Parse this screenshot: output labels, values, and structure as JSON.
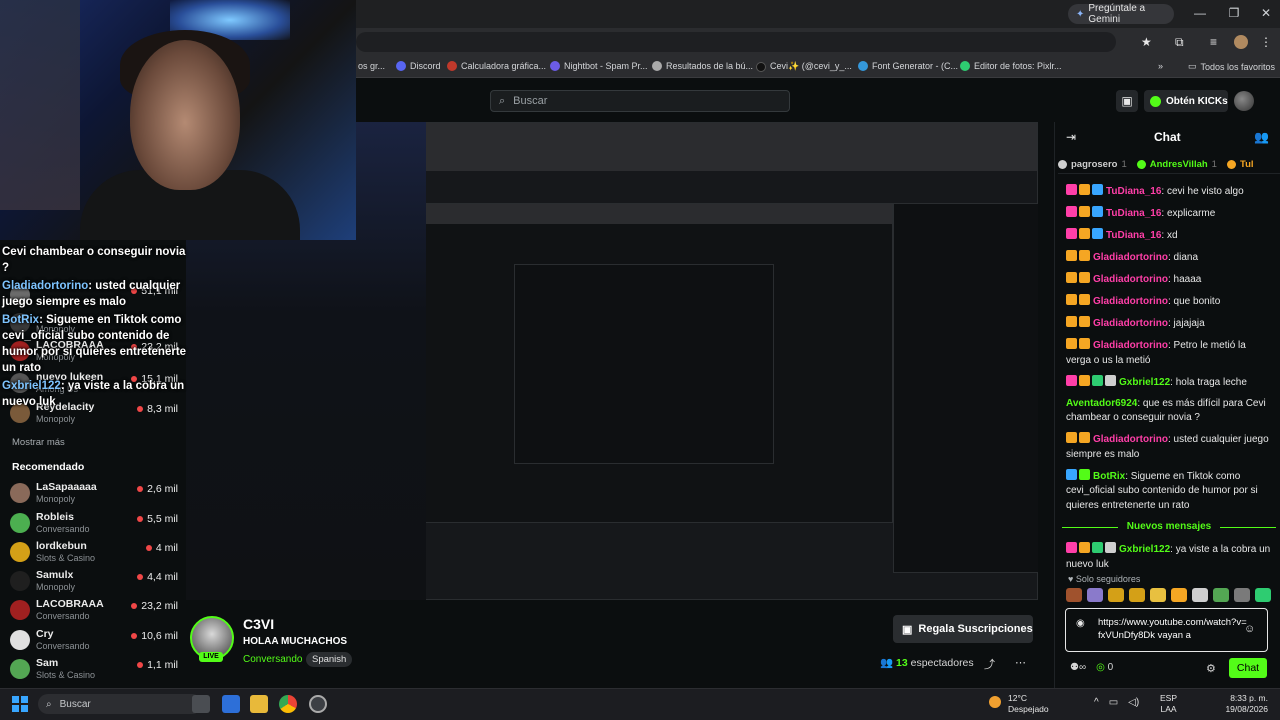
{
  "browser": {
    "gemini_button": "Pregúntale a Gemini",
    "bookmarks": [
      {
        "label": "os gr...",
        "color": "#888888"
      },
      {
        "label": "Discord",
        "color": "#5865f2"
      },
      {
        "label": "Calculadora gráfica...",
        "color": "#c0392b"
      },
      {
        "label": "Nightbot - Spam Pr...",
        "color": "#6c5ce7"
      },
      {
        "label": "Resultados de la bú...",
        "color": "#aaaaaa"
      },
      {
        "label": "Cevi✨ (@cevi_y_...",
        "color": "#111111"
      },
      {
        "label": "Font Generator - (C...",
        "color": "#3498db"
      },
      {
        "label": "Editor de fotos: Pixlr...",
        "color": "#2ecc71"
      }
    ],
    "all_favorites": "Todos los favoritos"
  },
  "header": {
    "search_placeholder": "Buscar",
    "kicks_button": "Obtén KICKs"
  },
  "overlay_chat": [
    {
      "text": "Cevi chambear o conseguir novia ?"
    },
    {
      "user": "Gladiadortorino",
      "text": ": usted cualquier juego siempre es malo"
    },
    {
      "user": "BotRix",
      "text": ": Sigueme en Tiktok como cevi_oficial subo contenido de humor por si quieres entretenerte un rato"
    },
    {
      "user": "Gxbriel122",
      "text": ": ya viste a la cobra un nuevo luk"
    }
  ],
  "sidebar": {
    "channels": [
      {
        "name": "",
        "category": "",
        "viewers": "51,1 mil",
        "color": "#6b6b6b"
      },
      {
        "name": "",
        "category": "Monopoly",
        "viewers": "",
        "color": "#3a3a3a"
      },
      {
        "name": "LACOBRAAA",
        "category": "Monopoly",
        "viewers": "23,2 mil",
        "color": "#a02020"
      },
      {
        "name": "nuevo lukeen",
        "category": "Among Us",
        "viewers": "15,1 mil",
        "color": "#555555"
      },
      {
        "name": "Reydelacity",
        "category": "Monopoly",
        "viewers": "8,3 mil",
        "color": "#7a5a3a"
      }
    ],
    "show_more": "Mostrar más",
    "recommended_title": "Recomendado",
    "recommended": [
      {
        "name": "LaSapaaaaa",
        "category": "Monopoly",
        "viewers": "2,6 mil",
        "color": "#8a6a5a"
      },
      {
        "name": "Robleis",
        "category": "Conversando",
        "viewers": "5,5 mil",
        "color": "#4caf50"
      },
      {
        "name": "lordkebun",
        "category": "Slots & Casino",
        "viewers": "4 mil",
        "color": "#d4a017"
      },
      {
        "name": "Samulx",
        "category": "Monopoly",
        "viewers": "4,4 mil",
        "color": "#1f1f1f"
      },
      {
        "name": "LACOBRAAA",
        "category": "Conversando",
        "viewers": "23,2 mil",
        "color": "#a02020"
      },
      {
        "name": "Cry",
        "category": "Conversando",
        "viewers": "10,6 mil",
        "color": "#e0e0e0"
      },
      {
        "name": "Sam",
        "category": "Slots & Casino",
        "viewers": "1,1 mil",
        "color": "#53a653"
      }
    ]
  },
  "stream": {
    "streamer_name": "C3VI",
    "title": "HOLAA MUCHACHOS",
    "category": "Conversando",
    "language": "Spanish",
    "live_label": "LIVE",
    "gift_subs_button": "Regala Suscripciones",
    "viewer_count": "13",
    "viewer_label": "espectadores"
  },
  "chat": {
    "title": "Chat",
    "pinned": [
      {
        "name": "pagrosero",
        "count": "1",
        "color": "#cfcfcf"
      },
      {
        "name": "AndresVillah",
        "count": "1",
        "color": "#53fc18"
      },
      {
        "name": "Tul",
        "count": "",
        "color": "#f5a623"
      }
    ],
    "messages": [
      {
        "user": "TuDiana_16",
        "text": ": cevi he visto algo",
        "color_class": "u-pink",
        "badges": [
          "#ff3fa8",
          "#f5a623",
          "#38a6ff"
        ]
      },
      {
        "user": "TuDiana_16",
        "text": ": explicarme",
        "color_class": "u-pink",
        "badges": [
          "#ff3fa8",
          "#f5a623",
          "#38a6ff"
        ]
      },
      {
        "user": "TuDiana_16",
        "text": ": xd",
        "color_class": "u-pink",
        "badges": [
          "#ff3fa8",
          "#f5a623",
          "#38a6ff"
        ]
      },
      {
        "user": "Gladiadortorino",
        "text": ": diana",
        "color_class": "u-pink",
        "badges": [
          "#f5a623",
          "#f5a623"
        ]
      },
      {
        "user": "Gladiadortorino",
        "text": ": haaaa",
        "color_class": "u-pink",
        "badges": [
          "#f5a623",
          "#f5a623"
        ]
      },
      {
        "user": "Gladiadortorino",
        "text": ": que bonito",
        "color_class": "u-pink",
        "badges": [
          "#f5a623",
          "#f5a623"
        ]
      },
      {
        "user": "Gladiadortorino",
        "text": ": jajajaja",
        "color_class": "u-pink",
        "badges": [
          "#f5a623",
          "#f5a623"
        ]
      },
      {
        "user": "Gladiadortorino",
        "text": ": Petro le metió la verga o us la metió",
        "color_class": "u-pink",
        "badges": [
          "#f5a623",
          "#f5a623"
        ]
      },
      {
        "user": "Gxbriel122",
        "text": ": hola traga leche",
        "color_class": "u-green",
        "badges": [
          "#ff3fa8",
          "#f5a623",
          "#2ecc71",
          "#cfcfcf"
        ]
      },
      {
        "user": "Aventador6924",
        "text": ": que es más difícil para Cevi chambear o conseguir novia ?",
        "color_class": "u-lime",
        "badges": []
      },
      {
        "user": "Gladiadortorino",
        "text": ": usted cualquier juego siempre es malo",
        "color_class": "u-pink",
        "badges": [
          "#f5a623",
          "#f5a623"
        ]
      },
      {
        "user": "BotRix",
        "text": ": Sigueme en Tiktok como cevi_oficial subo contenido de humor por si quieres entretenerte un rato",
        "color_class": "u-green",
        "badges": [
          "#38a6ff",
          "#53fc18"
        ]
      }
    ],
    "new_messages_label": "Nuevos mensajes",
    "new_messages": [
      {
        "user": "Gxbriel122",
        "text": ": ya viste a la cobra un nuevo luk",
        "color_class": "u-green",
        "badges": [
          "#ff3fa8",
          "#f5a623",
          "#2ecc71",
          "#cfcfcf"
        ]
      }
    ],
    "followers_only": "Solo seguidores",
    "follower_colors": [
      "#a0522d",
      "#8a7acb",
      "#d4a017",
      "#d4a017",
      "#e8c040",
      "#f5a623",
      "#cfcfcf",
      "#53a653",
      "#7a7a7a",
      "#2ecc71"
    ],
    "input_text": "https://www.youtube.com/watch?v=fxVUnDfy8Dk vayan a",
    "points": "0",
    "send_button": "Chat"
  },
  "taskbar": {
    "search_placeholder": "Buscar",
    "weather_temp": "12°C",
    "weather_desc": "Despejado",
    "lang_top": "ESP",
    "lang_bottom": "LAA",
    "time": "8:33 p. m.",
    "date": "19/08/2026"
  }
}
